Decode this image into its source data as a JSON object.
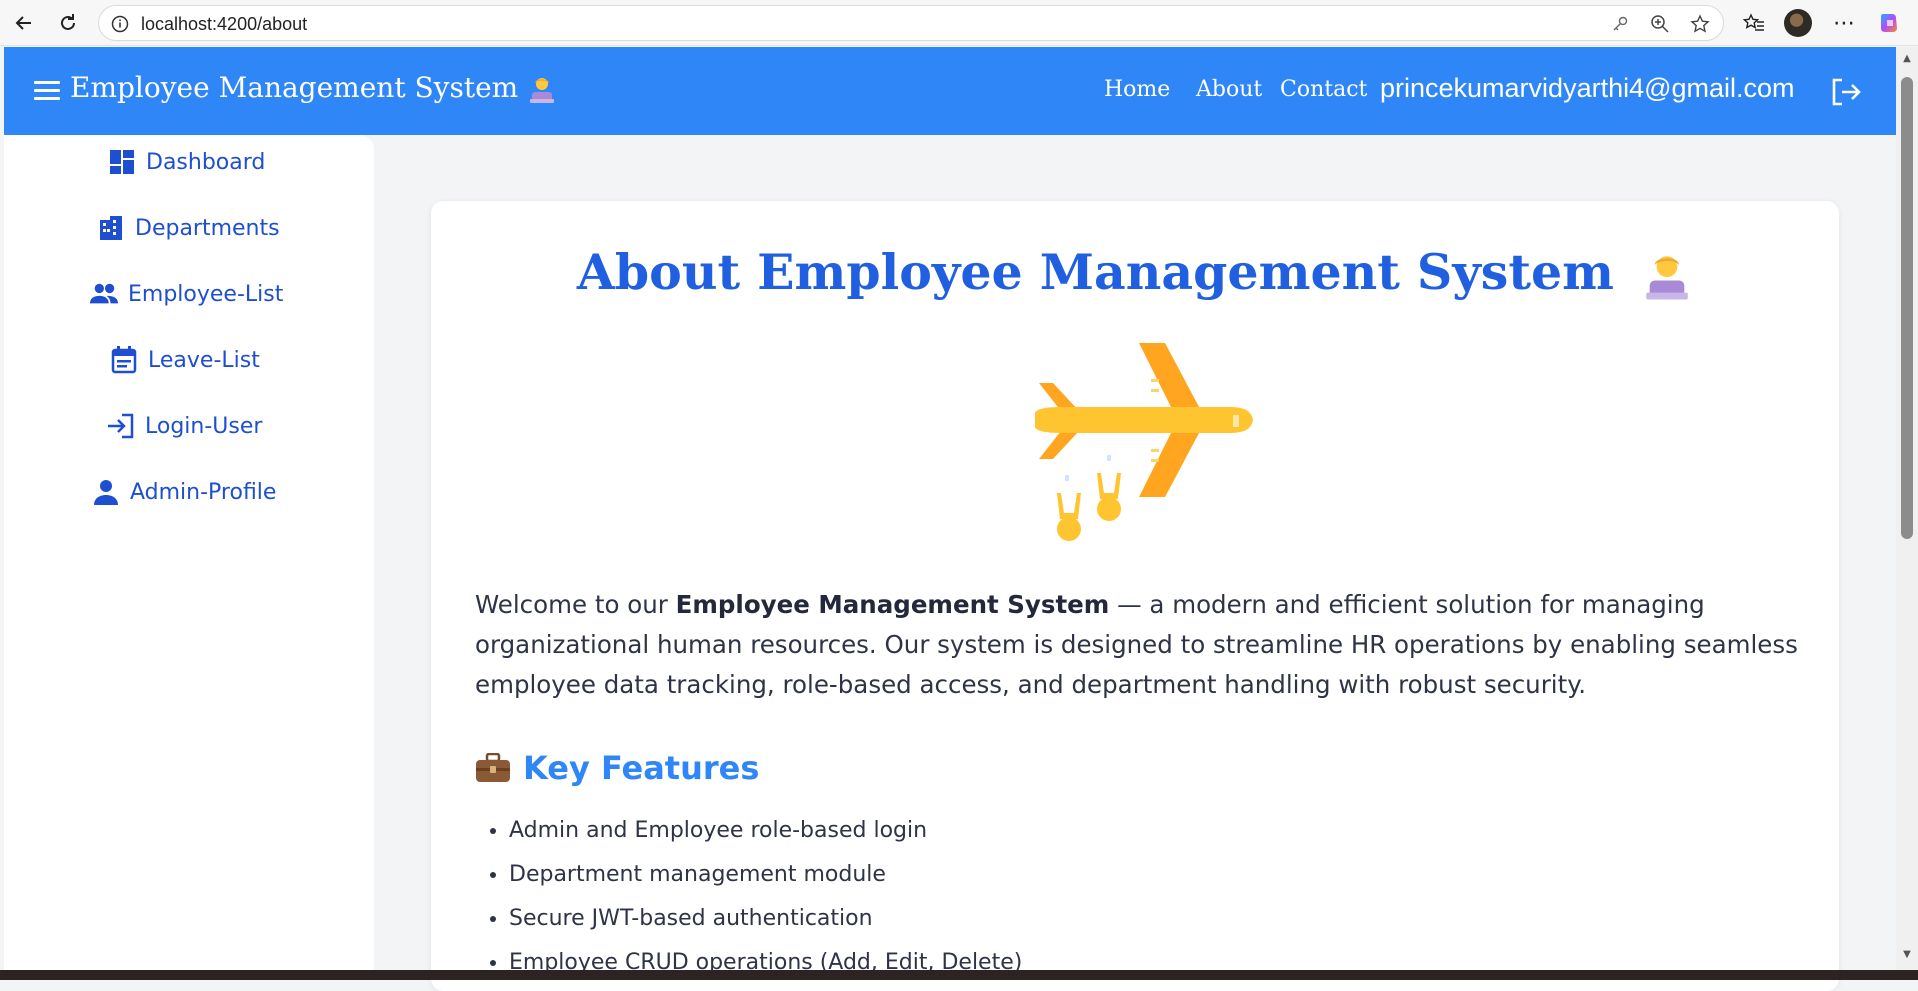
{
  "browser": {
    "url": "localhost:4200/about"
  },
  "header": {
    "app_title": "Employee Management System",
    "nav": [
      "Home",
      "About",
      "Contact"
    ],
    "user_email": "princekumarvidyarthi4@gmail.com",
    "brand_color": "#2f86f6"
  },
  "sidebar": {
    "items": [
      {
        "label": "Dashboard",
        "icon": "dashboard-icon"
      },
      {
        "label": "Departments",
        "icon": "building-icon"
      },
      {
        "label": "Employee-List",
        "icon": "people-icon"
      },
      {
        "label": "Leave-List",
        "icon": "calendar-icon"
      },
      {
        "label": "Login-User",
        "icon": "login-icon"
      },
      {
        "label": "Admin-Profile",
        "icon": "person-icon"
      }
    ]
  },
  "main": {
    "title": "About Employee Management System",
    "intro_prefix": "Welcome to our ",
    "intro_bold": "Employee Management System",
    "intro_suffix": " — a modern and efficient solution for managing organizational human resources. Our system is designed to streamline HR operations by enabling seamless employee data tracking, role-based access, and department handling with robust security.",
    "features_heading": "Key Features",
    "features": [
      "Admin and Employee role-based login",
      "Department management module",
      "Secure JWT-based authentication",
      "Employee CRUD operations (Add, Edit, Delete)"
    ],
    "title_color": "#1f5fe0"
  }
}
